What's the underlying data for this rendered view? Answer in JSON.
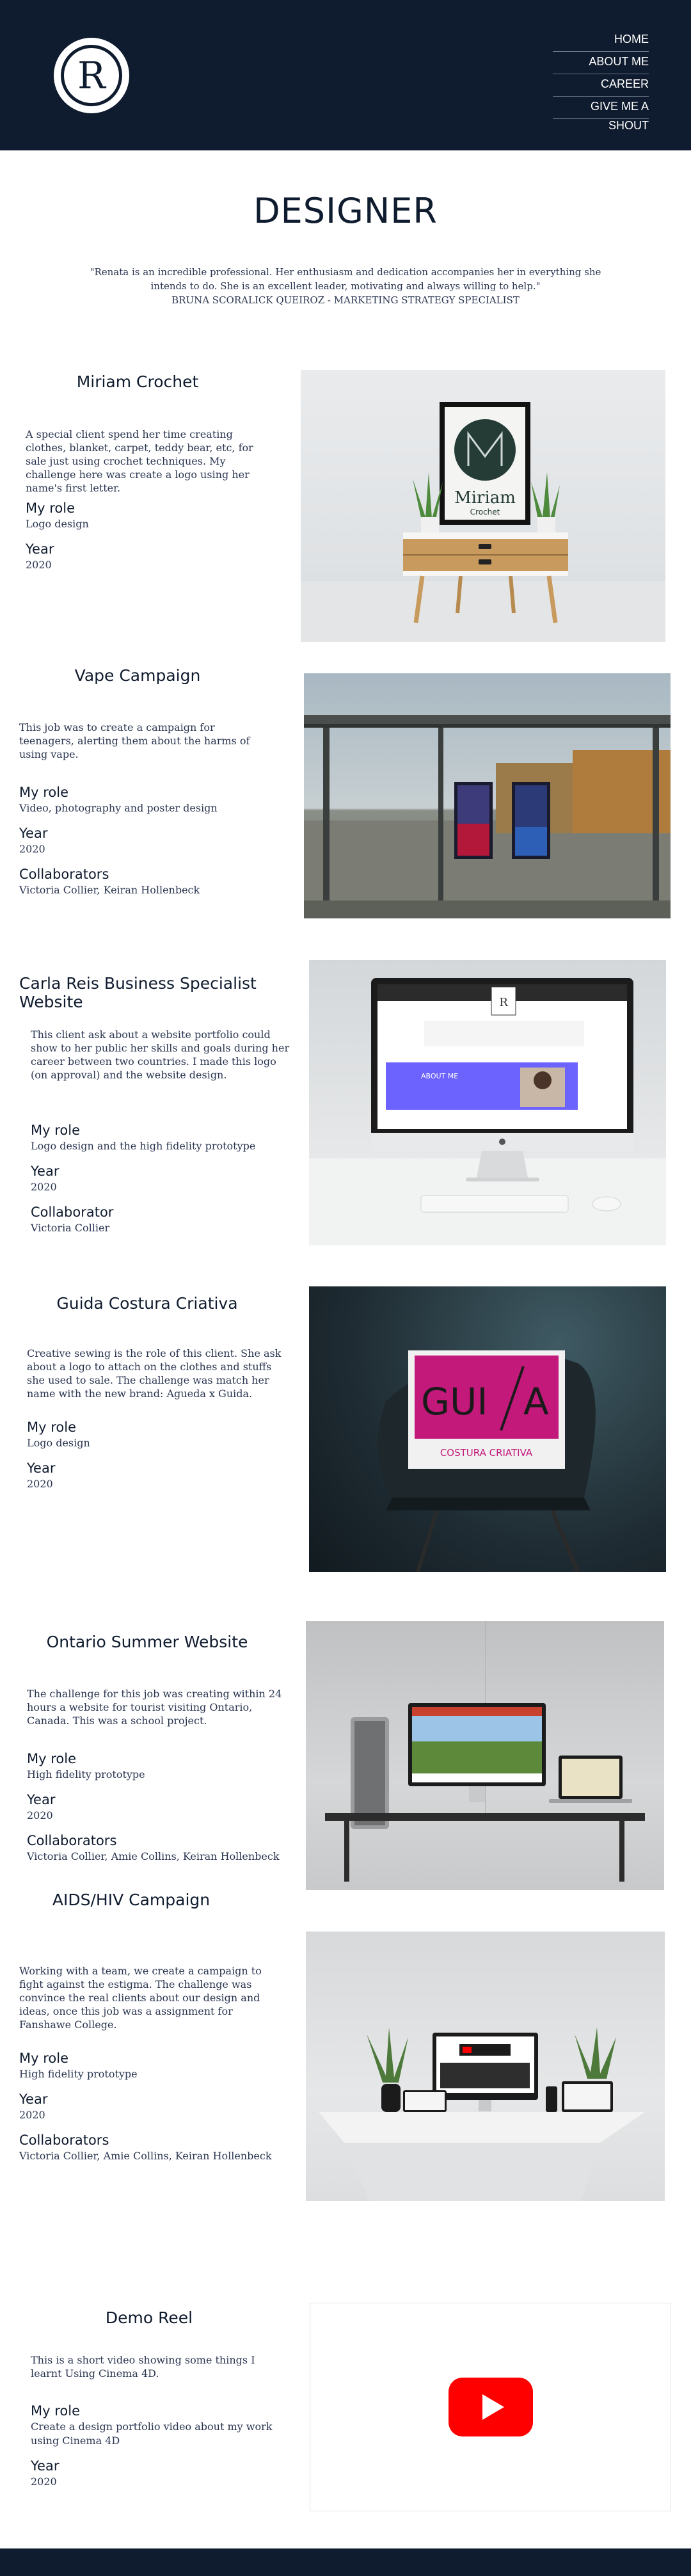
{
  "nav": [
    "HOME",
    "ABOUT ME",
    "CAREER",
    "GIVE ME A SHOUT"
  ],
  "logo_letter": "R",
  "page_title": "DESIGNER",
  "quote": {
    "text": "\"Renata is an incredible professional. Her enthusiasm and dedication accompanies her in everything she intends to do. She is an excellent leader, motivating and always willing to help.\"",
    "author": "BRUNA SCORALICK QUEIROZ - MARKETING STRATEGY SPECIALIST"
  },
  "projects": [
    {
      "title": "Miriam Crochet",
      "description": "A special client spend her time creating clothes, blanket, carpet, teddy bear, etc, for sale just using crochet techniques. My challenge here was create a logo using her name's first letter.",
      "role_label": "My role",
      "role": "Logo design",
      "year_label": "Year",
      "year": "2020",
      "image_text": "Miriam",
      "image_subtext": "Crochet"
    },
    {
      "title": "Vape Campaign",
      "description": "This job was to create a campaign for teenagers, alerting them about the harms of using vape.",
      "role_label": "My role",
      "role": "Video, photography and poster design",
      "year_label": "Year",
      "year": "2020",
      "collab_label": "Collaborators",
      "collab": "Victoria Collier, Keiran Hollenbeck"
    },
    {
      "title": "Carla Reis Business Specialist Website",
      "description": "This client ask about a website portfolio could show to her public her skills and goals during her career between two countries. I made this logo (on approval) and the website design.",
      "role_label": "My role",
      "role": "Logo design and the high fidelity prototype",
      "year_label": "Year",
      "year": "2020",
      "collab_label": "Collaborator",
      "collab": "Victoria Collier",
      "screen_heading": "ABOUT ME"
    },
    {
      "title": "Guida Costura Criativa",
      "description": "Creative sewing is the role of this client. She ask about a logo to attach on the clothes and stuffs she used to sale. The challenge was match her name with the new brand: Aguedа x Guida.",
      "role_label": "My role",
      "role": "Logo design",
      "year_label": "Year",
      "year": "2020",
      "image_text": "GUI",
      "image_text_b": "A",
      "image_subtext": "COSTURA CRIATIVA"
    },
    {
      "title": "Ontario Summer Website",
      "description": "The challenge for this job was creating within 24 hours a website for tourist visiting Ontario, Canada. This was a school project.",
      "role_label": "My role",
      "role": "High fidelity prototype",
      "year_label": "Year",
      "year": "2020",
      "collab_label": "Collaborators",
      "collab": "Victoria Collier, Amie Collins, Keiran Hollenbeck"
    },
    {
      "title": "AIDS/HIV Campaign",
      "description": "Working with a team, we create a campaign to fight against the estigma. The challenge was convince the real clients about our design and ideas, once this job was a assignment for Fanshawe College.",
      "role_label": "My role",
      "role": "High fidelity prototype",
      "year_label": "Year",
      "year": "2020",
      "collab_label": "Collaborators",
      "collab": "Victoria Collier, Amie Collins, Keiran Hollenbeck"
    },
    {
      "title": "Demo Reel",
      "description": "This is a short video showing some things I learnt Using Cinema 4D.",
      "role_label": "My role",
      "role": "Create a design portfolio video about my work using Cinema 4D",
      "year_label": "Year",
      "year": "2020"
    }
  ],
  "colors": {
    "navy": "#0f1b2e",
    "youtube_red": "#ff0000",
    "guida_magenta": "#c2197a"
  }
}
